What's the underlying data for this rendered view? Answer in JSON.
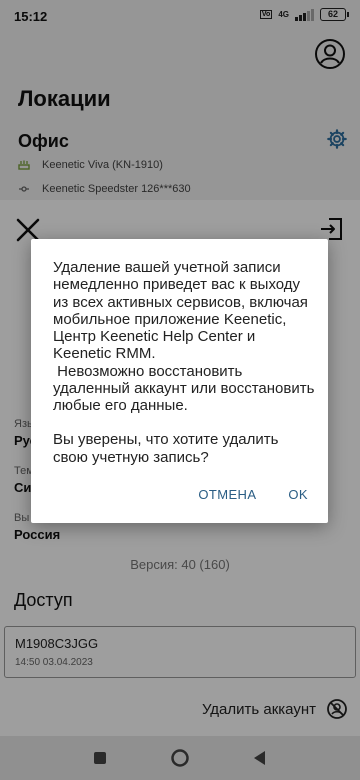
{
  "status": {
    "time": "15:12",
    "network": "4G",
    "battery": "62"
  },
  "page": {
    "title": "Локации"
  },
  "location": {
    "name": "Офис",
    "devices": [
      {
        "icon": "router-icon",
        "label": "Keenetic Viva (KN-1910)"
      },
      {
        "icon": "extender-icon",
        "label": "Keenetic Speedster 126***630"
      }
    ]
  },
  "settings": {
    "language": {
      "label_partial": "Язы",
      "value_partial": "Рус"
    },
    "theme": {
      "label_partial": "Тем",
      "value_partial": "Си"
    },
    "region": {
      "label_partial": "Вы",
      "value": "Россия"
    }
  },
  "version": "Версия: 40 (160)",
  "access": {
    "title": "Доступ",
    "item": {
      "id": "M1908C3JGG",
      "date": "14:50 03.04.2023"
    }
  },
  "delete_account": {
    "label": "Удалить аккаунт"
  },
  "dialog": {
    "message": "Удаление вашей учетной записи немедленно приведет вас к выходу из всех активных сервисов, включая мобильное приложение Keenetic, Центр Keenetic Help Center и Keenetic RMM.\n Невозможно восстановить удаленный аккаунт или восстановить любые его данные.",
    "question": "Вы уверены, что хотите удалить свою учетную запись?",
    "cancel": "ОТМЕНА",
    "ok": "OK"
  },
  "colors": {
    "accent": "#2a5d84",
    "router_icon": "#7aa13a",
    "gear": "#2e6e9e"
  }
}
